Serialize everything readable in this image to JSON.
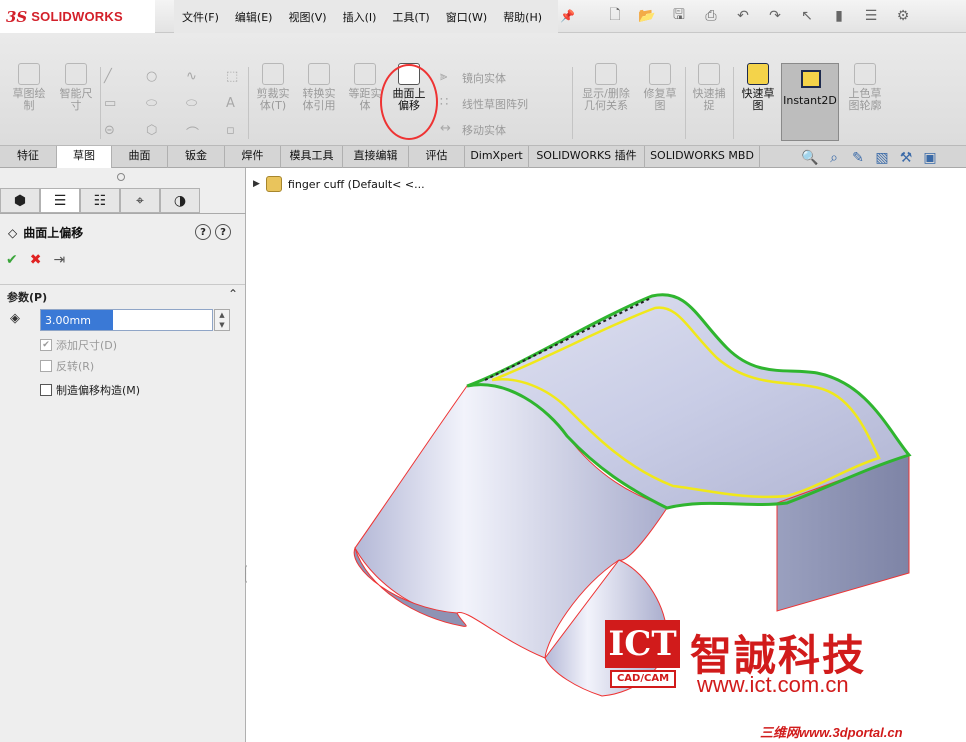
{
  "app": {
    "logo_ds": "3S",
    "logo_name": "SOLIDWORKS"
  },
  "menu": [
    "文件(F)",
    "编辑(E)",
    "视图(V)",
    "插入(I)",
    "工具(T)",
    "窗口(W)",
    "帮助(H)"
  ],
  "ribbon": {
    "sketch_draw": "草图绘\n制",
    "smart_dim": "智能尺\n寸",
    "trim": "剪裁实\n体(T)",
    "convert": "转换实\n体引用",
    "offset_entities": "等距实\n体",
    "offset_on_surface": "曲面上\n偏移",
    "mirror": "镜向实体",
    "linear_pattern": "线性草图阵列",
    "move": "移动实体",
    "show_relations": "显示/删除\n几何关系",
    "repair": "修复草\n图",
    "quick_snap": "快速捕\n捉",
    "rapid_sketch": "快速草\n图",
    "instant2d": "Instant2D",
    "shaded_sketch": "上色草\n图轮廓"
  },
  "tabs": [
    "特征",
    "草图",
    "曲面",
    "钣金",
    "焊件",
    "模具工具",
    "直接编辑",
    "评估",
    "DimXpert",
    "SOLIDWORKS 插件",
    "SOLIDWORKS MBD"
  ],
  "selected_tab": "草图",
  "property_manager": {
    "title": "曲面上偏移",
    "group_label": "参数(P)",
    "distance_value": "3.00mm",
    "add_dimension": "添加尺寸(D)",
    "reverse": "反转(R)",
    "construction": "制造偏移构造(M)"
  },
  "tree": {
    "item": "finger cuff  (Default< <..."
  },
  "watermark": {
    "ict": "ICT",
    "ict_sub": "CAD/CAM",
    "company": "智誠科技",
    "url": "www.ict.com.cn",
    "portal": "三维网www.3dportal.cn"
  },
  "colors": {
    "accent_red": "#d11b1b",
    "selected_input": "#3a79d6",
    "green_edge": "#2fb52f",
    "yellow_offset": "#f0e81a"
  }
}
